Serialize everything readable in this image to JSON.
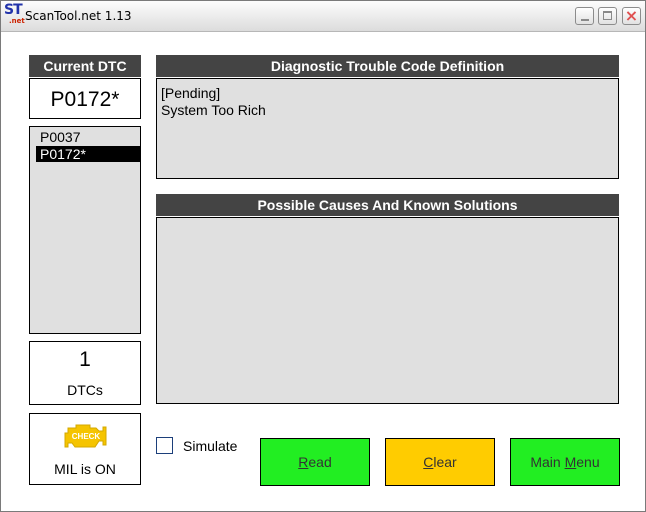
{
  "window": {
    "title": "ScanTool.net 1.13",
    "icon_text": "ST",
    "icon_sub": ".net"
  },
  "current_dtc": {
    "header": "Current DTC",
    "value": "P0172*"
  },
  "dtc_list": [
    {
      "code": "P0037",
      "selected": false
    },
    {
      "code": "P0172*",
      "selected": true
    }
  ],
  "dtc_count": {
    "number": "1",
    "label": "DTCs"
  },
  "mil": {
    "icon_text": "CHECK",
    "label": "MIL is ON",
    "icon_color": "#f5c400"
  },
  "definition": {
    "header": "Diagnostic Trouble Code Definition",
    "line1": "[Pending]",
    "line2": "System Too Rich"
  },
  "causes": {
    "header": "Possible Causes And Known Solutions",
    "text": ""
  },
  "simulate": {
    "label": "Simulate",
    "checked": false
  },
  "buttons": {
    "read": {
      "key": "R",
      "rest": "ead"
    },
    "clear": {
      "key": "C",
      "rest": "lear"
    },
    "menu": {
      "pre": "Main ",
      "key": "M",
      "rest": "enu"
    }
  },
  "colors": {
    "header_bg": "#444444",
    "panel_bg": "#e0e0e0",
    "green": "#22ee22",
    "yellow": "#ffcc00"
  }
}
